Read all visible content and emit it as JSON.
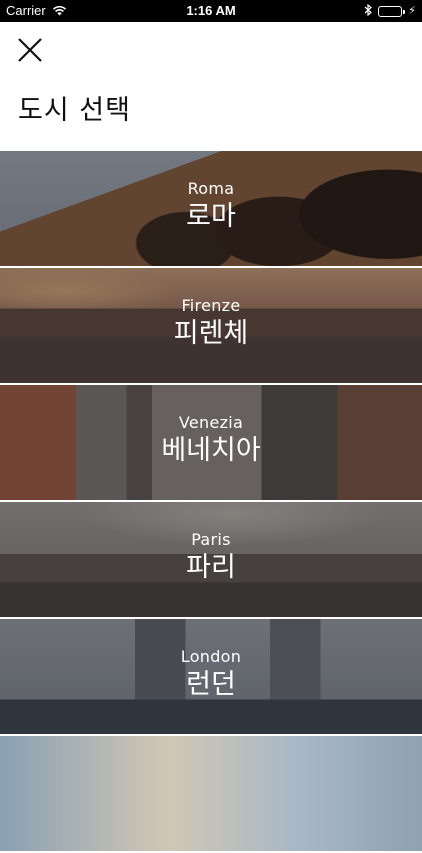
{
  "status_bar": {
    "carrier": "Carrier",
    "time": "1:16 AM"
  },
  "header": {
    "close_icon": "close-icon",
    "title": "도시 선택"
  },
  "cities": [
    {
      "name_en": "Roma",
      "name_ko": "로마"
    },
    {
      "name_en": "Firenze",
      "name_ko": "피렌체"
    },
    {
      "name_en": "Venezia",
      "name_ko": "베네치아"
    },
    {
      "name_en": "Paris",
      "name_ko": "파리"
    },
    {
      "name_en": "London",
      "name_ko": "런던"
    }
  ],
  "colors": {
    "battery_fill": "#4cd964",
    "title_text": "#111111",
    "card_text": "#ffffff"
  }
}
